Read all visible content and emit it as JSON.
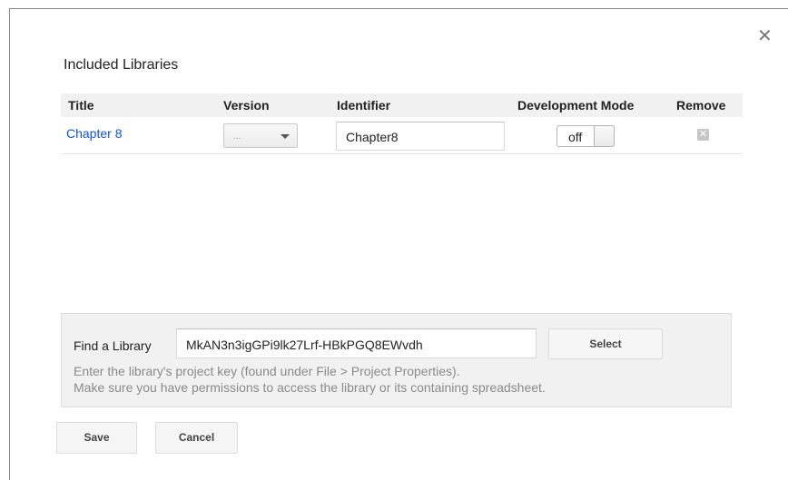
{
  "dialog": {
    "close_icon": "close-icon",
    "title": "Included Libraries"
  },
  "table": {
    "headers": [
      "Title",
      "Version",
      "Identifier",
      "Development Mode",
      "Remove"
    ],
    "rows": [
      {
        "title": "Chapter 8",
        "version": "...",
        "identifier": "Chapter8",
        "development_mode": "off",
        "remove_icon": "remove-icon"
      }
    ]
  },
  "find_library": {
    "label": "Find a Library",
    "value": "MkAN3n3igGPi9lk27Lrf-HBkPGQ8EWvdh",
    "select_label": "Select",
    "help_line1": "Enter the library's project key (found under File > Project Properties).",
    "help_line2": "Make sure you have permissions to access the library or its containing spreadsheet."
  },
  "footer": {
    "save_label": "Save",
    "cancel_label": "Cancel"
  },
  "colors": {
    "link": "#1155cc",
    "panel_bg": "#f1f1f1",
    "help_text": "#8a8a8a"
  }
}
